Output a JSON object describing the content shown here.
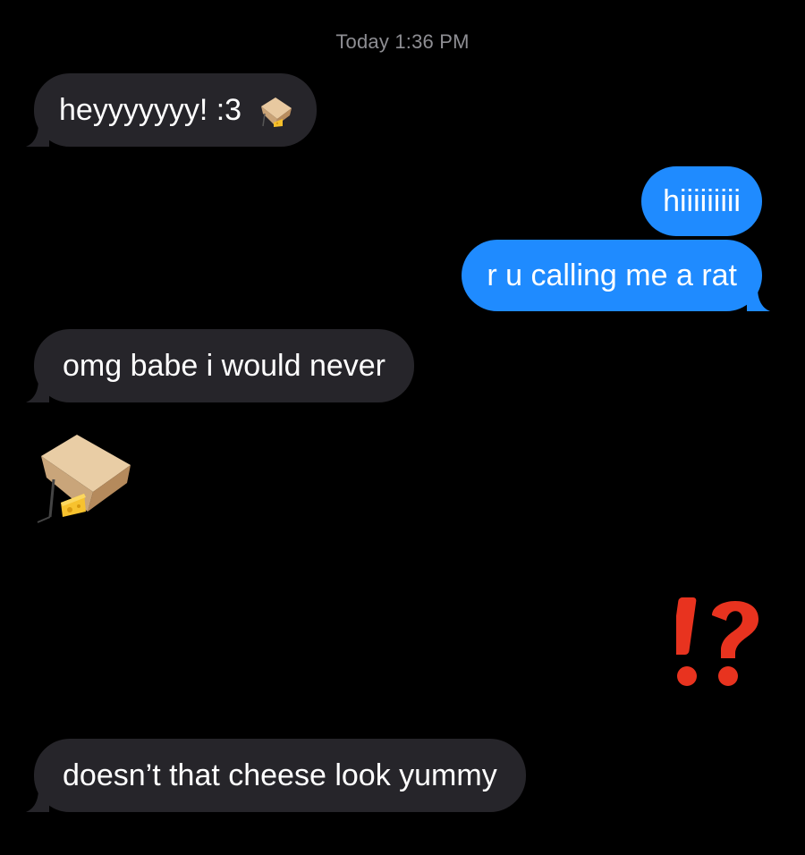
{
  "conversation": {
    "timestamp": "Today 1:36 PM",
    "messages": [
      {
        "direction": "incoming",
        "text": "heyyyyyyy! :3",
        "emoji": "mousetrap-icon"
      },
      {
        "direction": "outgoing",
        "text": "hiiiiiiiii"
      },
      {
        "direction": "outgoing",
        "text": "r u calling me a rat"
      },
      {
        "direction": "incoming",
        "text": "omg babe i would never"
      },
      {
        "direction": "incoming",
        "emoji_only": "mousetrap-icon"
      },
      {
        "direction": "incoming",
        "text": "doesn’t that cheese look yummy"
      }
    ],
    "reaction": "⁉️"
  },
  "colors": {
    "background": "#000000",
    "incoming_bubble": "#26252a",
    "outgoing_bubble": "#1f8bff",
    "timestamp": "#8e8e93",
    "reaction_red": "#e8331f"
  }
}
